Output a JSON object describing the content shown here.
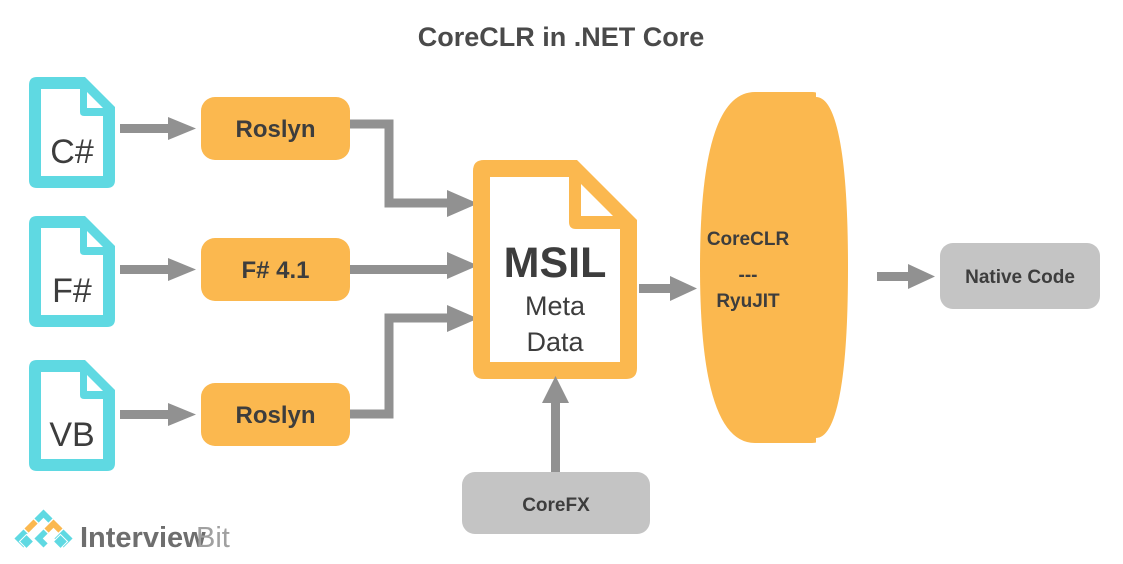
{
  "title": "CoreCLR in .NET Core",
  "colors": {
    "orange": "#FBB84F",
    "cyan": "#5FD9E2",
    "gray_box": "#C4C4C4",
    "arrow_gray": "#919191",
    "text_dark": "#3D3D3D",
    "title_gray": "#4A4A4A",
    "white": "#FFFFFF",
    "logo_dark": "#6E6E6E",
    "logo_light": "#A0A0A0"
  },
  "sources": [
    {
      "id": "csharp",
      "label": "C#",
      "icon": "document-icon"
    },
    {
      "id": "fsharp",
      "label": "F#",
      "icon": "document-icon"
    },
    {
      "id": "vb",
      "label": "VB",
      "icon": "document-icon"
    }
  ],
  "compilers": [
    {
      "id": "roslyn-csharp",
      "label": "Roslyn"
    },
    {
      "id": "fsharp-compiler",
      "label": "F# 4.1"
    },
    {
      "id": "roslyn-vb",
      "label": "Roslyn"
    }
  ],
  "msil": {
    "icon": "document-icon",
    "line1": "MSIL",
    "line2": "Meta",
    "line3": "Data"
  },
  "runtime": {
    "shape": "cylinder",
    "line1": "CoreCLR",
    "line2": "---",
    "line3": "RyuJIT"
  },
  "output": {
    "label": "Native Code"
  },
  "framework": {
    "label": "CoreFX"
  },
  "logo": {
    "name_bold": "Interview",
    "name_light": "Bit",
    "mark": "diamond-grid-icon"
  }
}
